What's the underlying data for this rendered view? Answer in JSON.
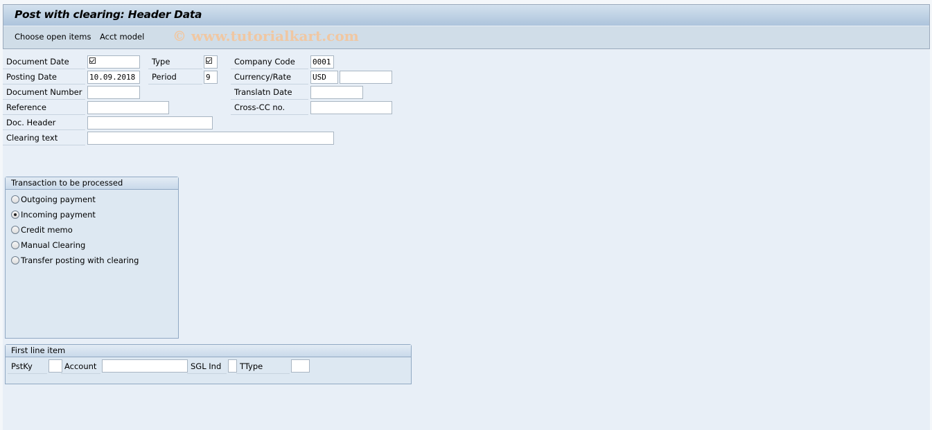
{
  "window": {
    "title": "Post with clearing: Header Data",
    "watermark": "© www.tutorialkart.com"
  },
  "toolbar": {
    "choose_open_items": "Choose open items",
    "acct_model": "Acct model"
  },
  "header_fields": {
    "document_date": {
      "label": "Document Date",
      "value": "",
      "required": true
    },
    "type": {
      "label": "Type",
      "value": "",
      "required": true
    },
    "company_code": {
      "label": "Company Code",
      "value": "0001"
    },
    "posting_date": {
      "label": "Posting Date",
      "value": "10.09.2018"
    },
    "period": {
      "label": "Period",
      "value": "9"
    },
    "currency_rate": {
      "label": "Currency/Rate",
      "currency": "USD",
      "rate": ""
    },
    "document_number": {
      "label": "Document Number",
      "value": ""
    },
    "translation_date": {
      "label": "Translatn Date",
      "value": ""
    },
    "reference": {
      "label": "Reference",
      "value": ""
    },
    "cross_cc_no": {
      "label": "Cross-CC no.",
      "value": ""
    },
    "doc_header": {
      "label": "Doc. Header",
      "value": ""
    },
    "clearing_text": {
      "label": "Clearing text",
      "value": ""
    }
  },
  "transaction_group": {
    "title": "Transaction to be processed",
    "options": [
      {
        "label": "Outgoing payment",
        "selected": false
      },
      {
        "label": "Incoming payment",
        "selected": true
      },
      {
        "label": "Credit memo",
        "selected": false
      },
      {
        "label": "Manual Clearing",
        "selected": false
      },
      {
        "label": "Transfer posting with clearing",
        "selected": false
      }
    ]
  },
  "first_line_item": {
    "title": "First line item",
    "pstky": {
      "label": "PstKy",
      "value": ""
    },
    "account": {
      "label": "Account",
      "value": ""
    },
    "sgl_ind": {
      "label": "SGL Ind",
      "value": ""
    },
    "ttype": {
      "label": "TType",
      "value": ""
    }
  }
}
